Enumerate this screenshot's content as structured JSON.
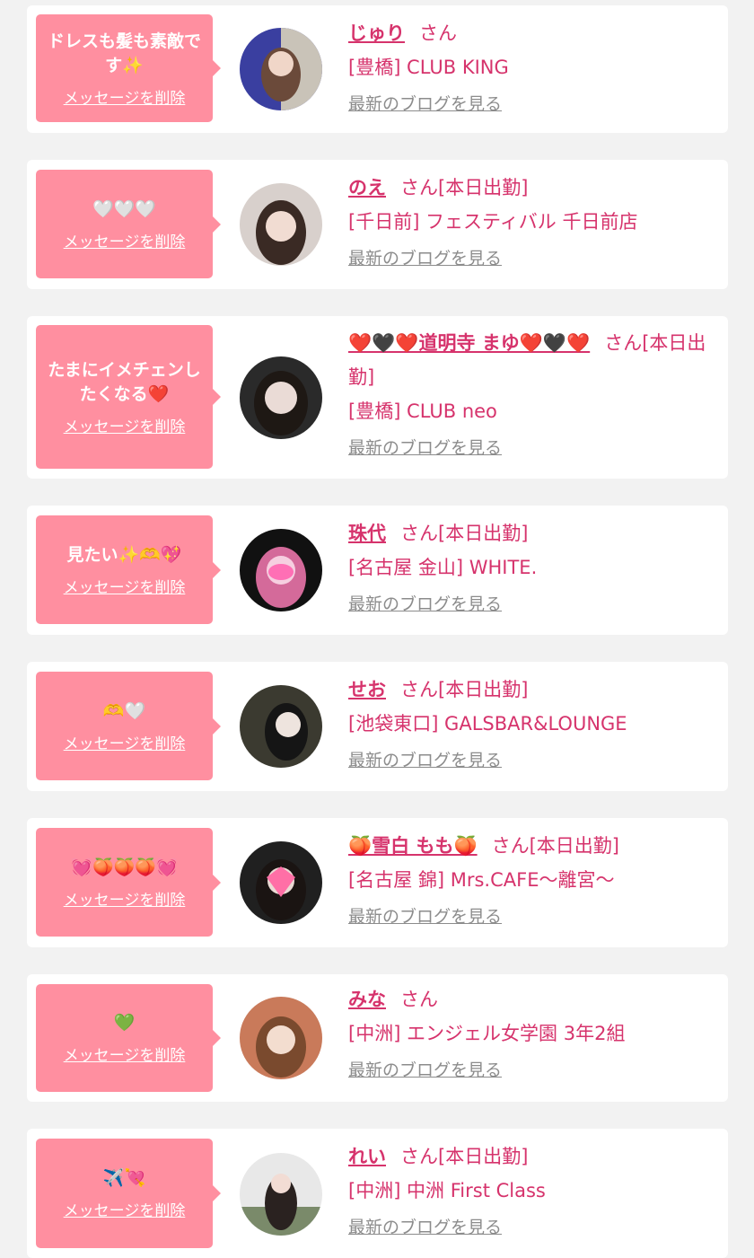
{
  "entries": [
    {
      "message": "ドレスも髪も素敵です✨",
      "delete_label": "メッセージを削除",
      "name": "じゅり",
      "suffix": "さん",
      "shop": "[豊橋] CLUB KING",
      "blog_label": "最新のブログを見る"
    },
    {
      "message": "🤍🤍🤍",
      "delete_label": "メッセージを削除",
      "name": "のえ",
      "suffix": "さん[本日出勤]",
      "shop": "[千日前] フェスティバル 千日前店",
      "blog_label": "最新のブログを見る"
    },
    {
      "message": "たまにイメチェンしたくなる❤️",
      "delete_label": "メッセージを削除",
      "name": "❤️🖤❤️道明寺 まゆ❤️🖤❤️",
      "suffix": "さん[本日出勤]",
      "shop": "[豊橋] CLUB neo",
      "blog_label": "最新のブログを見る"
    },
    {
      "message": "見たい✨🫶💖",
      "delete_label": "メッセージを削除",
      "name": "珠代",
      "suffix": "さん[本日出勤]",
      "shop": "[名古屋 金山] WHITE.",
      "blog_label": "最新のブログを見る"
    },
    {
      "message": "🫶🤍",
      "delete_label": "メッセージを削除",
      "name": "せお",
      "suffix": "さん[本日出勤]",
      "shop": "[池袋東口] GALSBAR&LOUNGE",
      "blog_label": "最新のブログを見る"
    },
    {
      "message": "💓🍑🍑🍑💓",
      "delete_label": "メッセージを削除",
      "name": "🍑雪白 もも🍑",
      "suffix": "さん[本日出勤]",
      "shop": "[名古屋 錦] Mrs.CAFE〜離宮〜",
      "blog_label": "最新のブログを見る"
    },
    {
      "message": "💚",
      "delete_label": "メッセージを削除",
      "name": "みな",
      "suffix": "さん",
      "shop": "[中洲] エンジェル女学園 3年2組",
      "blog_label": "最新のブログを見る"
    },
    {
      "message": "✈️💘",
      "delete_label": "メッセージを削除",
      "name": "れい",
      "suffix": "さん[本日出勤]",
      "shop": "[中洲] 中洲 First Class",
      "blog_label": "最新のブログを見る"
    }
  ],
  "colors": {
    "bubble": "#ff8fa0",
    "accent": "#d6336c",
    "link_gray": "#8c8c8c",
    "background": "#f2f2f2"
  }
}
